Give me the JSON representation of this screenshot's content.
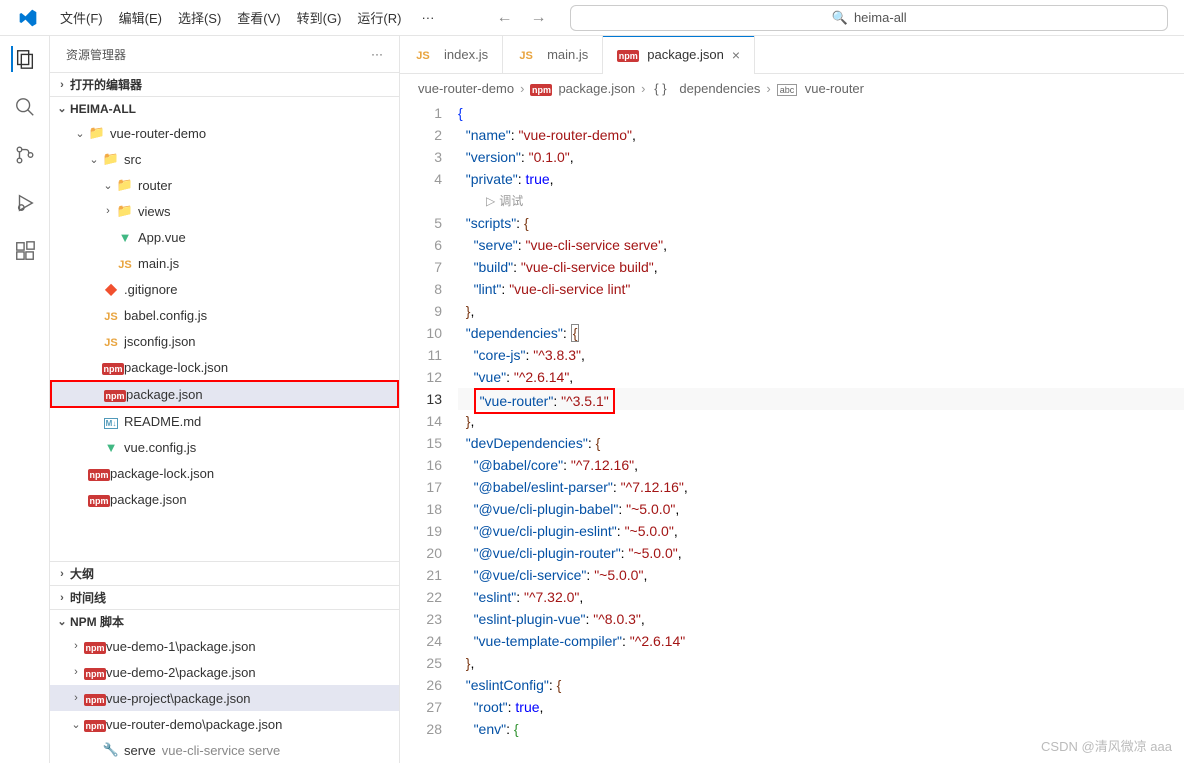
{
  "titlebar": {
    "menu": [
      "文件(F)",
      "编辑(E)",
      "选择(S)",
      "查看(V)",
      "转到(G)",
      "运行(R)"
    ],
    "dots": "···",
    "search_text": "heima-all"
  },
  "sidebar": {
    "title": "资源管理器",
    "dots": "···",
    "open_editors": "打开的编辑器",
    "root": "HEIMA-ALL",
    "tree": [
      {
        "indent": 1,
        "chev": "v",
        "icon": "folder",
        "label": "vue-router-demo"
      },
      {
        "indent": 2,
        "chev": "v",
        "icon": "folder-src",
        "label": "src"
      },
      {
        "indent": 3,
        "chev": "v",
        "icon": "folder-router",
        "label": "router"
      },
      {
        "indent": 3,
        "chev": ">",
        "icon": "folder-views",
        "label": "views"
      },
      {
        "indent": 3,
        "chev": "",
        "icon": "vue",
        "label": "App.vue"
      },
      {
        "indent": 3,
        "chev": "",
        "icon": "js",
        "label": "main.js"
      },
      {
        "indent": 2,
        "chev": "",
        "icon": "git",
        "label": ".gitignore"
      },
      {
        "indent": 2,
        "chev": "",
        "icon": "js",
        "label": "babel.config.js"
      },
      {
        "indent": 2,
        "chev": "",
        "icon": "js",
        "label": "jsconfig.json"
      },
      {
        "indent": 2,
        "chev": "",
        "icon": "npm",
        "label": "package-lock.json"
      },
      {
        "indent": 2,
        "chev": "",
        "icon": "npm",
        "label": "package.json",
        "selected": true
      },
      {
        "indent": 2,
        "chev": "",
        "icon": "md",
        "label": "README.md"
      },
      {
        "indent": 2,
        "chev": "",
        "icon": "vue",
        "label": "vue.config.js"
      },
      {
        "indent": 1,
        "chev": "",
        "icon": "npm",
        "label": "package-lock.json"
      },
      {
        "indent": 1,
        "chev": "",
        "icon": "npm",
        "label": "package.json"
      }
    ],
    "outline": "大纲",
    "timeline": "时间线",
    "npm_scripts": "NPM 脚本",
    "npm_items": [
      {
        "chev": ">",
        "icon": "npm",
        "label": "vue-demo-1\\package.json"
      },
      {
        "chev": ">",
        "icon": "npm",
        "label": "vue-demo-2\\package.json"
      },
      {
        "chev": ">",
        "icon": "npm",
        "label": "vue-project\\package.json",
        "selected": true
      },
      {
        "chev": "v",
        "icon": "npm",
        "label": "vue-router-demo\\package.json"
      },
      {
        "chev": "",
        "icon": "wrench",
        "label": "serve",
        "suffix": "vue-cli-service serve"
      }
    ]
  },
  "tabs": [
    {
      "icon": "js",
      "label": "index.js"
    },
    {
      "icon": "js",
      "label": "main.js"
    },
    {
      "icon": "npm",
      "label": "package.json",
      "active": true,
      "closable": true
    }
  ],
  "breadcrumb": [
    "vue-router-demo",
    "package.json",
    "dependencies",
    "vue-router"
  ],
  "breadcrumb_icons": [
    "",
    "npm",
    "braces",
    "abc"
  ],
  "codelens": "调试",
  "code_lines": [
    {
      "n": 1,
      "t": [
        [
          "brace2",
          "{"
        ]
      ]
    },
    {
      "n": 2,
      "t": [
        [
          "",
          "  "
        ],
        [
          "key",
          "\"name\""
        ],
        [
          "punct",
          ": "
        ],
        [
          "str",
          "\"vue-router-demo\""
        ],
        [
          "punct",
          ","
        ]
      ]
    },
    {
      "n": 3,
      "t": [
        [
          "",
          "  "
        ],
        [
          "key",
          "\"version\""
        ],
        [
          "punct",
          ": "
        ],
        [
          "str",
          "\"0.1.0\""
        ],
        [
          "punct",
          ","
        ]
      ]
    },
    {
      "n": 4,
      "t": [
        [
          "",
          "  "
        ],
        [
          "key",
          "\"private\""
        ],
        [
          "punct",
          ": "
        ],
        [
          "bool",
          "true"
        ],
        [
          "punct",
          ","
        ]
      ]
    },
    {
      "n": "cl"
    },
    {
      "n": 5,
      "t": [
        [
          "",
          "  "
        ],
        [
          "key",
          "\"scripts\""
        ],
        [
          "punct",
          ": "
        ],
        [
          "brace3",
          "{"
        ]
      ]
    },
    {
      "n": 6,
      "t": [
        [
          "",
          "    "
        ],
        [
          "key",
          "\"serve\""
        ],
        [
          "punct",
          ": "
        ],
        [
          "str",
          "\"vue-cli-service serve\""
        ],
        [
          "punct",
          ","
        ]
      ]
    },
    {
      "n": 7,
      "t": [
        [
          "",
          "    "
        ],
        [
          "key",
          "\"build\""
        ],
        [
          "punct",
          ": "
        ],
        [
          "str",
          "\"vue-cli-service build\""
        ],
        [
          "punct",
          ","
        ]
      ]
    },
    {
      "n": 8,
      "t": [
        [
          "",
          "    "
        ],
        [
          "key",
          "\"lint\""
        ],
        [
          "punct",
          ": "
        ],
        [
          "str",
          "\"vue-cli-service lint\""
        ]
      ]
    },
    {
      "n": 9,
      "t": [
        [
          "",
          "  "
        ],
        [
          "brace3",
          "}"
        ],
        [
          "punct",
          ","
        ]
      ]
    },
    {
      "n": 10,
      "t": [
        [
          "",
          "  "
        ],
        [
          "key",
          "\"dependencies\""
        ],
        [
          "punct",
          ": "
        ],
        [
          "brace3",
          "{"
        ]
      ],
      "box_brace": true
    },
    {
      "n": 11,
      "t": [
        [
          "",
          "    "
        ],
        [
          "key",
          "\"core-js\""
        ],
        [
          "punct",
          ": "
        ],
        [
          "str",
          "\"^3.8.3\""
        ],
        [
          "punct",
          ","
        ]
      ]
    },
    {
      "n": 12,
      "t": [
        [
          "",
          "    "
        ],
        [
          "key",
          "\"vue\""
        ],
        [
          "punct",
          ": "
        ],
        [
          "str",
          "\"^2.6.14\""
        ],
        [
          "punct",
          ","
        ]
      ]
    },
    {
      "n": 13,
      "t": [
        [
          "",
          "    "
        ],
        [
          "key",
          "\"vue-router\""
        ],
        [
          "punct",
          ": "
        ],
        [
          "str",
          "\"^3.5.1\""
        ]
      ],
      "redbox": true,
      "hl": true
    },
    {
      "n": 14,
      "t": [
        [
          "",
          "  "
        ],
        [
          "brace3",
          "}"
        ],
        [
          "punct",
          ","
        ]
      ]
    },
    {
      "n": 15,
      "t": [
        [
          "",
          "  "
        ],
        [
          "key",
          "\"devDependencies\""
        ],
        [
          "punct",
          ": "
        ],
        [
          "brace3",
          "{"
        ]
      ]
    },
    {
      "n": 16,
      "t": [
        [
          "",
          "    "
        ],
        [
          "key",
          "\"@babel/core\""
        ],
        [
          "punct",
          ": "
        ],
        [
          "str",
          "\"^7.12.16\""
        ],
        [
          "punct",
          ","
        ]
      ]
    },
    {
      "n": 17,
      "t": [
        [
          "",
          "    "
        ],
        [
          "key",
          "\"@babel/eslint-parser\""
        ],
        [
          "punct",
          ": "
        ],
        [
          "str",
          "\"^7.12.16\""
        ],
        [
          "punct",
          ","
        ]
      ]
    },
    {
      "n": 18,
      "t": [
        [
          "",
          "    "
        ],
        [
          "key",
          "\"@vue/cli-plugin-babel\""
        ],
        [
          "punct",
          ": "
        ],
        [
          "str",
          "\"~5.0.0\""
        ],
        [
          "punct",
          ","
        ]
      ]
    },
    {
      "n": 19,
      "t": [
        [
          "",
          "    "
        ],
        [
          "key",
          "\"@vue/cli-plugin-eslint\""
        ],
        [
          "punct",
          ": "
        ],
        [
          "str",
          "\"~5.0.0\""
        ],
        [
          "punct",
          ","
        ]
      ]
    },
    {
      "n": 20,
      "t": [
        [
          "",
          "    "
        ],
        [
          "key",
          "\"@vue/cli-plugin-router\""
        ],
        [
          "punct",
          ": "
        ],
        [
          "str",
          "\"~5.0.0\""
        ],
        [
          "punct",
          ","
        ]
      ]
    },
    {
      "n": 21,
      "t": [
        [
          "",
          "    "
        ],
        [
          "key",
          "\"@vue/cli-service\""
        ],
        [
          "punct",
          ": "
        ],
        [
          "str",
          "\"~5.0.0\""
        ],
        [
          "punct",
          ","
        ]
      ]
    },
    {
      "n": 22,
      "t": [
        [
          "",
          "    "
        ],
        [
          "key",
          "\"eslint\""
        ],
        [
          "punct",
          ": "
        ],
        [
          "str",
          "\"^7.32.0\""
        ],
        [
          "punct",
          ","
        ]
      ]
    },
    {
      "n": 23,
      "t": [
        [
          "",
          "    "
        ],
        [
          "key",
          "\"eslint-plugin-vue\""
        ],
        [
          "punct",
          ": "
        ],
        [
          "str",
          "\"^8.0.3\""
        ],
        [
          "punct",
          ","
        ]
      ]
    },
    {
      "n": 24,
      "t": [
        [
          "",
          "    "
        ],
        [
          "key",
          "\"vue-template-compiler\""
        ],
        [
          "punct",
          ": "
        ],
        [
          "str",
          "\"^2.6.14\""
        ]
      ]
    },
    {
      "n": 25,
      "t": [
        [
          "",
          "  "
        ],
        [
          "brace3",
          "}"
        ],
        [
          "punct",
          ","
        ]
      ]
    },
    {
      "n": 26,
      "t": [
        [
          "",
          "  "
        ],
        [
          "key",
          "\"eslintConfig\""
        ],
        [
          "punct",
          ": "
        ],
        [
          "brace3",
          "{"
        ]
      ]
    },
    {
      "n": 27,
      "t": [
        [
          "",
          "    "
        ],
        [
          "key",
          "\"root\""
        ],
        [
          "punct",
          ": "
        ],
        [
          "bool",
          "true"
        ],
        [
          "punct",
          ","
        ]
      ]
    },
    {
      "n": 28,
      "t": [
        [
          "",
          "    "
        ],
        [
          "key",
          "\"env\""
        ],
        [
          "punct",
          ": "
        ],
        [
          "brace",
          "{"
        ]
      ]
    }
  ],
  "watermark": "CSDN @清风微凉 aaa"
}
